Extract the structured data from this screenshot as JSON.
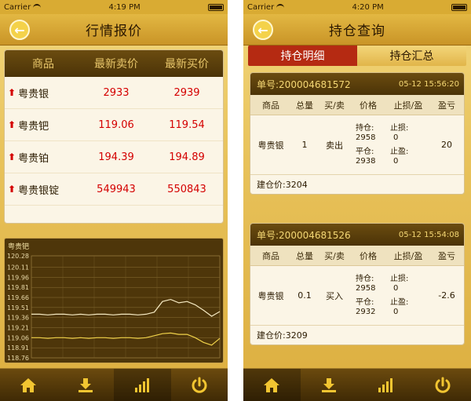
{
  "left": {
    "status": {
      "carrier": "Carrier",
      "time": "4:19 PM"
    },
    "nav": {
      "title": "行情报价"
    },
    "table": {
      "headers": [
        "商品",
        "最新卖价",
        "最新买价"
      ],
      "rows": [
        {
          "name": "粤贵银",
          "sell": "2933",
          "buy": "2939"
        },
        {
          "name": "粤贵钯",
          "sell": "119.06",
          "buy": "119.54"
        },
        {
          "name": "粤贵铂",
          "sell": "194.39",
          "buy": "194.89"
        },
        {
          "name": "粤贵银锭",
          "sell": "549943",
          "buy": "550843"
        }
      ]
    },
    "chart_title": "粤贵钯",
    "chart_data": {
      "type": "line",
      "title": "粤贵钯",
      "y_ticks": [
        "120.28",
        "120.11",
        "119.96",
        "119.81",
        "119.66",
        "119.51",
        "119.36",
        "119.21",
        "119.06",
        "118.91",
        "118.76"
      ],
      "ylim": [
        118.76,
        120.28
      ],
      "series": [
        {
          "color": "#f5e9c2",
          "values": [
            119.41,
            119.41,
            119.4,
            119.41,
            119.41,
            119.4,
            119.41,
            119.4,
            119.41,
            119.41,
            119.4,
            119.41,
            119.41,
            119.4,
            119.41,
            119.44,
            119.6,
            119.63,
            119.58,
            119.6,
            119.55,
            119.47,
            119.38,
            119.45
          ]
        },
        {
          "color": "#f0d24a",
          "values": [
            119.06,
            119.06,
            119.05,
            119.06,
            119.06,
            119.05,
            119.06,
            119.05,
            119.06,
            119.06,
            119.05,
            119.06,
            119.06,
            119.05,
            119.06,
            119.09,
            119.12,
            119.13,
            119.11,
            119.11,
            119.06,
            118.99,
            118.95,
            119.05
          ]
        }
      ]
    },
    "tabs": [
      "home-icon",
      "download-icon",
      "bars-chart-icon",
      "power-icon"
    ]
  },
  "right": {
    "status": {
      "carrier": "Carrier",
      "time": "4:20 PM"
    },
    "nav": {
      "title": "持仓查询"
    },
    "segments": [
      "持仓明细",
      "持仓汇总"
    ],
    "column_headers": [
      "商品",
      "总量",
      "买/卖",
      "价格",
      "止损/盈",
      "盈亏"
    ],
    "orders": [
      {
        "no_label": "单号:200004681572",
        "time": "05-12 15:56:20",
        "product": "粤贵银",
        "qty": "1",
        "side": "卖出",
        "hold_label": "持仓:",
        "hold_price": "2958",
        "close_label": "平仓:",
        "close_price": "2938",
        "stop_loss_label": "止损:",
        "stop_loss": "0",
        "take_profit_label": "止盈:",
        "take_profit": "0",
        "pnl": "20",
        "open_price": "建仓价:3204"
      },
      {
        "no_label": "单号:200004681526",
        "time": "05-12 15:54:08",
        "product": "粤贵银",
        "qty": "0.1",
        "side": "买入",
        "hold_label": "持仓:",
        "hold_price": "2958",
        "close_label": "平仓:",
        "close_price": "2932",
        "stop_loss_label": "止损:",
        "stop_loss": "0",
        "take_profit_label": "止盈:",
        "take_profit": "0",
        "pnl": "-2.6",
        "open_price": "建仓价:3209"
      }
    ]
  }
}
